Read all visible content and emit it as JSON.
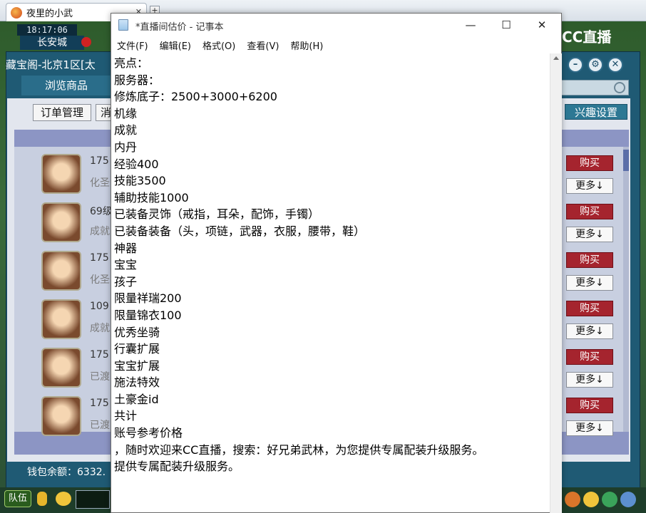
{
  "browser": {
    "tab_title": "夜里的小武",
    "tab_close": "✕",
    "new_tab": "+"
  },
  "game": {
    "clock": "18:17:06",
    "location": "长安城",
    "brand": "CC直播",
    "panel_title": "藏宝阁-北京1区[太",
    "browse_label": "浏览商品",
    "order_label": "订单管理",
    "msg_label": "消",
    "interest_label": "兴趣设置",
    "wallet_label": "钱包余额：6332.",
    "team_label": "队伍",
    "items": [
      {
        "line1": "175",
        "line2": "化圣",
        "buy": "购买",
        "more": "更多↓"
      },
      {
        "line1": "69级",
        "line2": "成就",
        "buy": "购买",
        "more": "更多↓"
      },
      {
        "line1": "175",
        "line2": "化圣",
        "buy": "购买",
        "more": "更多↓"
      },
      {
        "line1": "109",
        "line2": "成就",
        "buy": "购买",
        "more": "更多↓"
      },
      {
        "line1": "175",
        "line2": "已渡",
        "buy": "购买",
        "more": "更多↓"
      },
      {
        "line1": "175",
        "line2": "已渡",
        "buy": "购买",
        "more": "更多↓"
      }
    ]
  },
  "notepad": {
    "title": "*直播间估价 - 记事本",
    "controls": {
      "minimize": "—",
      "maximize": "☐",
      "close": "✕"
    },
    "menu": [
      "文件(F)",
      "编辑(E)",
      "格式(O)",
      "查看(V)",
      "帮助(H)"
    ],
    "lines": [
      "亮点：",
      "服务器：",
      "修炼底子：2500+3000+6200",
      "机缘",
      "成就",
      "内丹",
      "经验400",
      "技能3500",
      "辅助技能1000",
      "已装备灵饰（戒指，耳朵，配饰，手镯）",
      "已装备装备（头，项链，武器，衣服，腰带，鞋）",
      "神器",
      "宝宝",
      "孩子",
      "限量祥瑞200",
      "限量锦衣100",
      "优秀坐骑",
      "行囊扩展",
      "宝宝扩展",
      "施法特效",
      "土豪金id",
      "共计",
      "账号参考价格",
      "，随时欢迎来CC直播，搜索：好兄弟武林，为您提供专属配装升级服务。",
      "提供专属配装升级服务。"
    ]
  }
}
